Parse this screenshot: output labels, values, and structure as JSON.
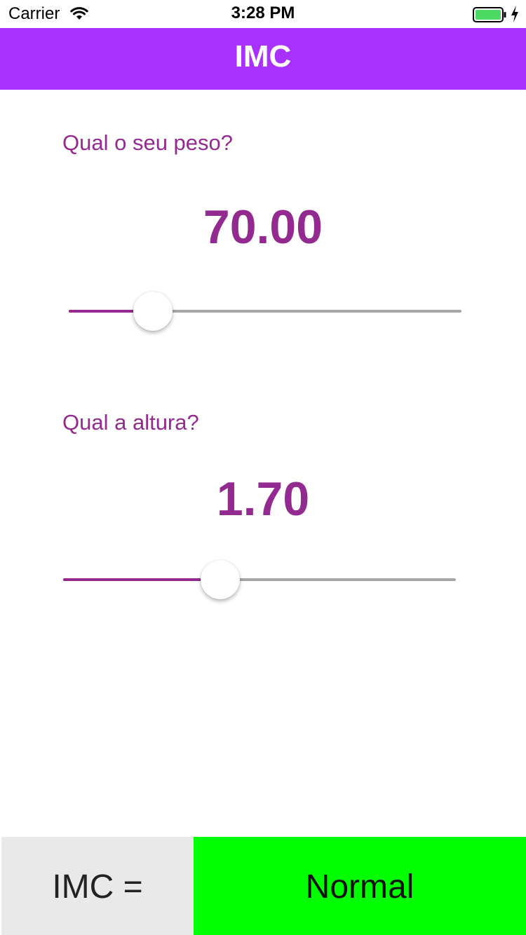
{
  "status_bar": {
    "carrier": "Carrier",
    "time": "3:28 PM",
    "icons": [
      "wifi-icon",
      "battery-icon",
      "charging-icon"
    ],
    "battery_color": "#4cd964"
  },
  "nav": {
    "title": "IMC",
    "background": "#a931fd"
  },
  "weight": {
    "question": "Qual o seu peso?",
    "value": "70.00",
    "slider_fraction": 0.215
  },
  "height": {
    "question": "Qual a altura?",
    "value": "1.70",
    "slider_fraction": 0.4
  },
  "result": {
    "label": "IMC =",
    "status": "Normal",
    "status_color": "#00ff00"
  },
  "colors": {
    "accent": "#922a8f",
    "track": "#a6a6a6"
  }
}
